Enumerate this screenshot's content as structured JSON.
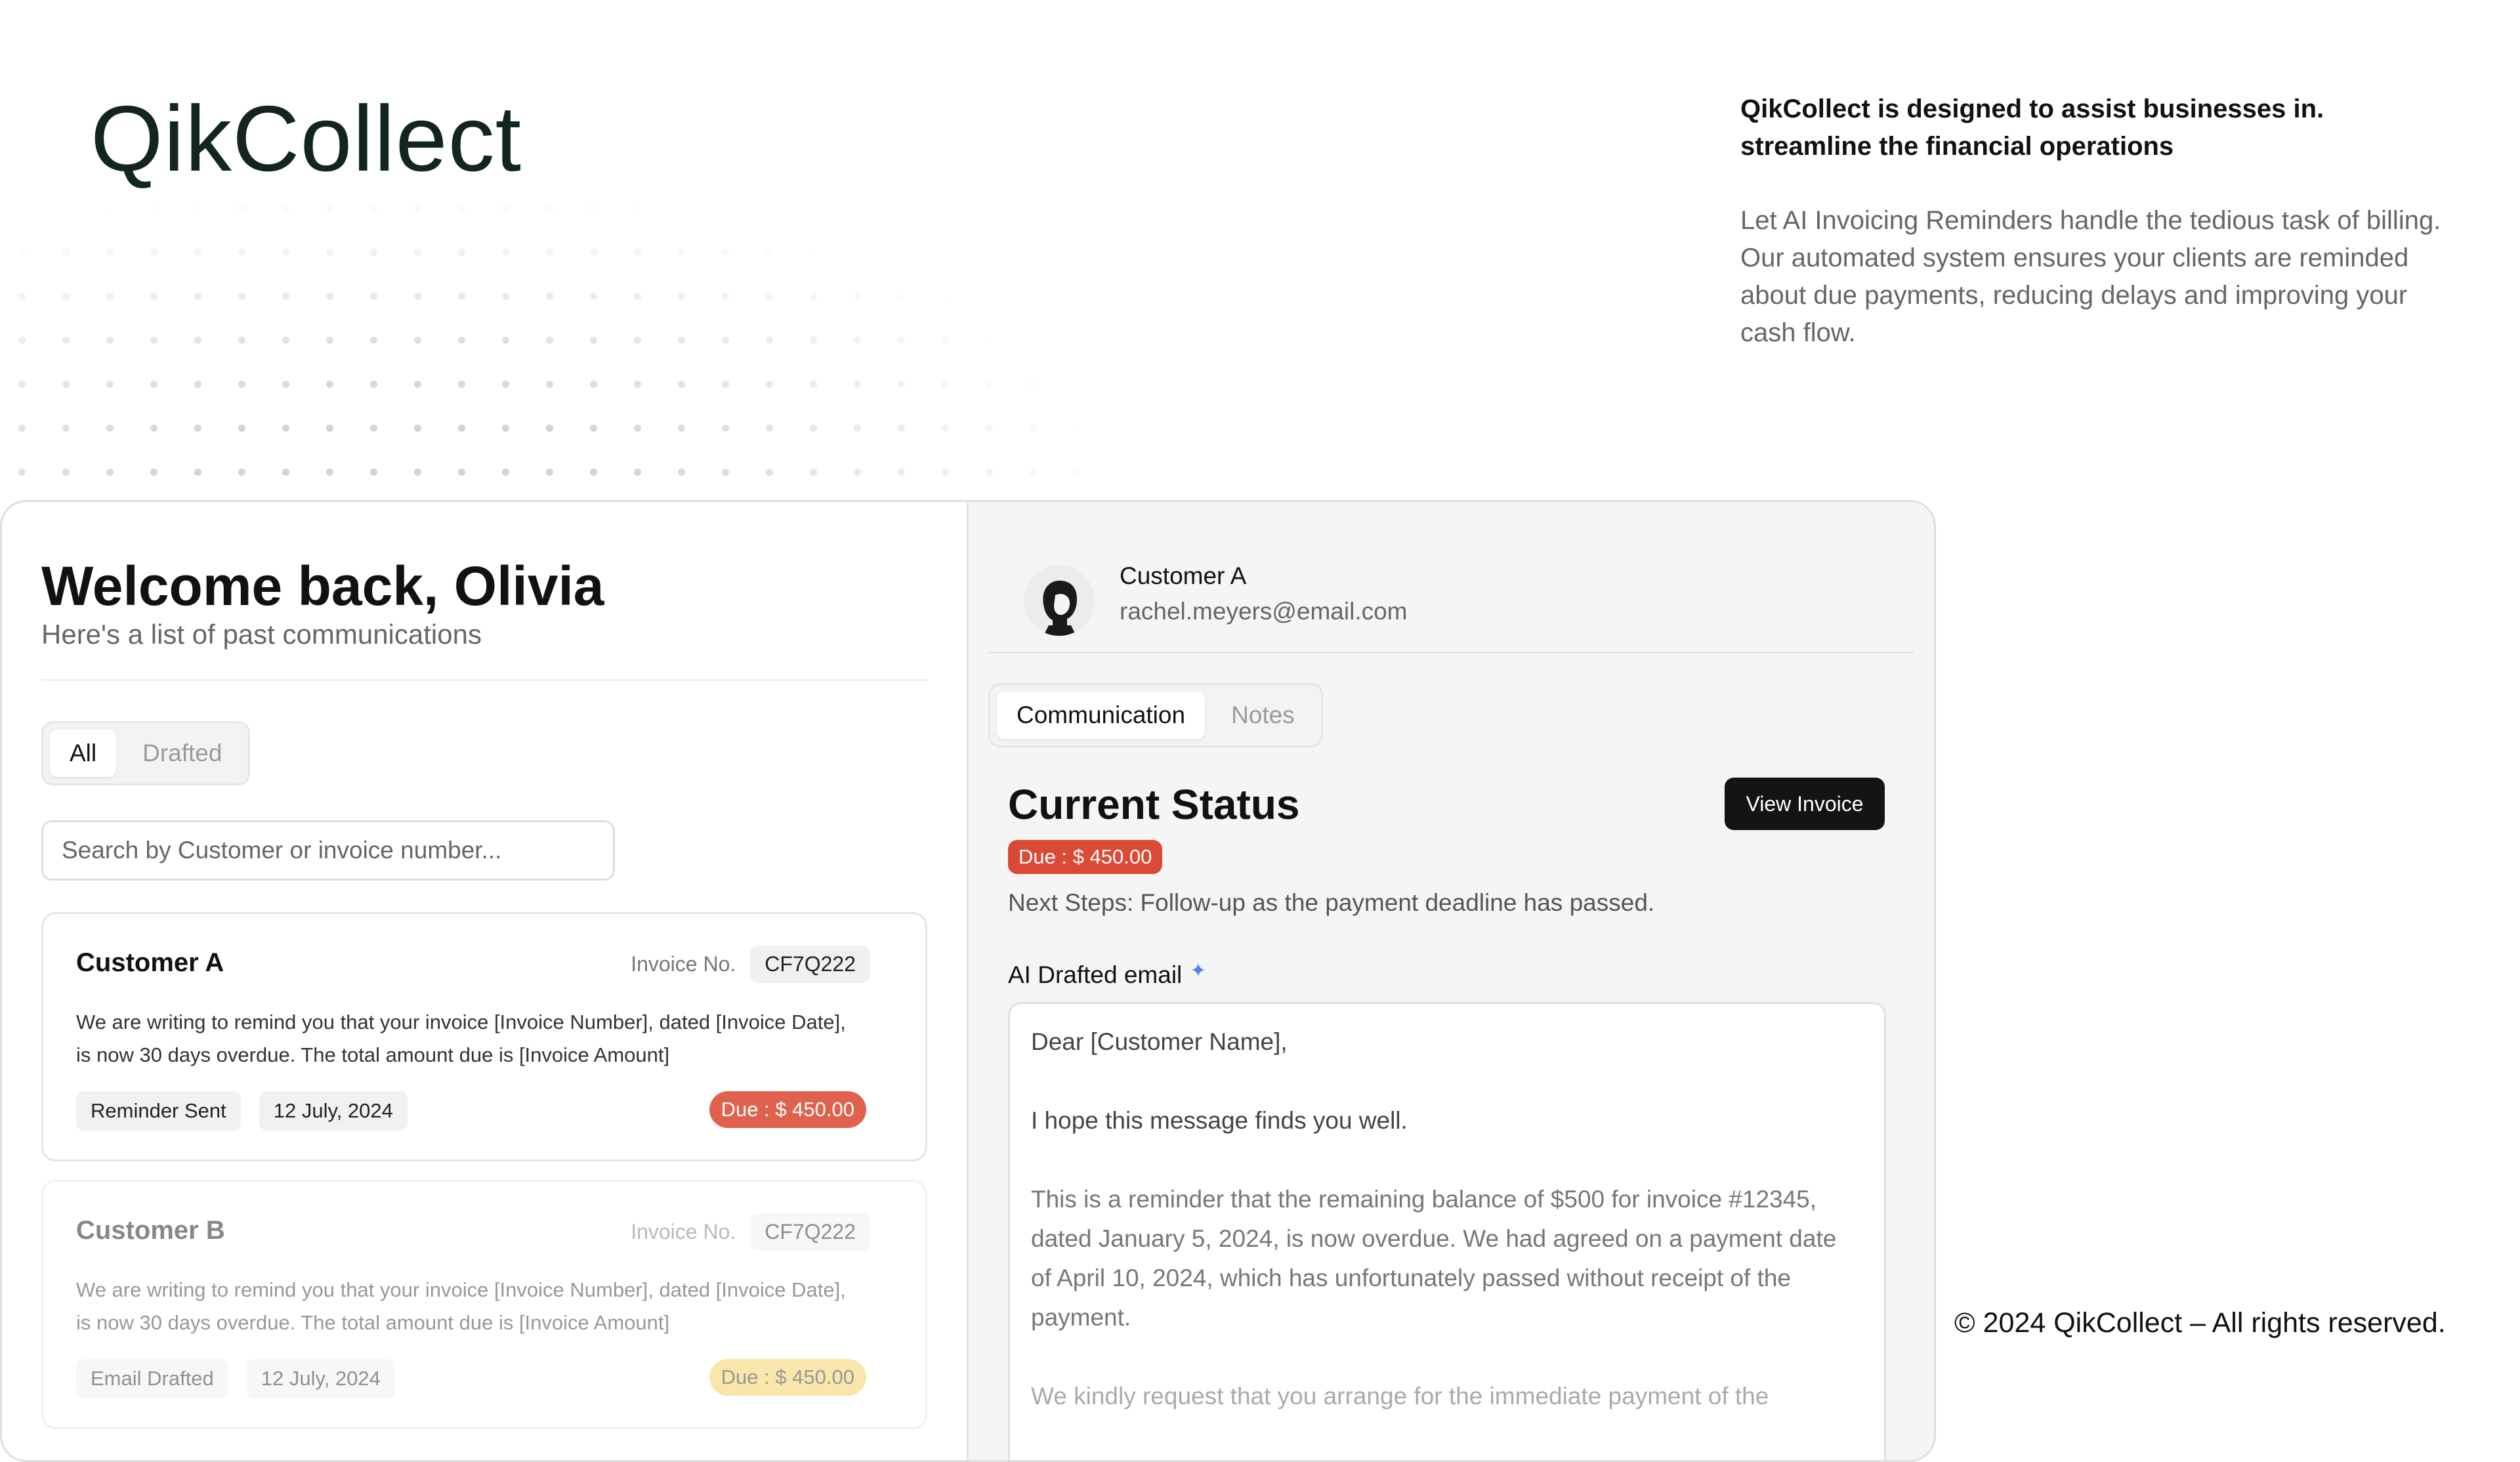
{
  "brand": "QikCollect",
  "intro": {
    "title": "QikCollect is designed to assist businesses in. streamline the financial operations",
    "body": "Let AI Invoicing Reminders handle the tedious task of billing. Our automated system ensures your clients are reminded about due payments, reducing delays and improving your cash flow."
  },
  "footer": "© 2024 QikCollect – All rights reserved.",
  "left": {
    "welcome": "Welcome back, Olivia",
    "subtitle": "Here's a list of past communications",
    "tabs": [
      "All",
      "Drafted"
    ],
    "search_placeholder": "Search by Customer or invoice number...",
    "cards": [
      {
        "customer": "Customer A",
        "invoice_label": "Invoice No.",
        "invoice_no": "CF7Q222",
        "text": "We are writing to remind you that your invoice [Invoice Number], dated [Invoice Date], is now 30 days overdue. The total amount due is [Invoice Amount]",
        "status": "Reminder Sent",
        "date": "12 July, 2024",
        "due": "Due : $ 450.00"
      },
      {
        "customer": "Customer B",
        "invoice_label": "Invoice No.",
        "invoice_no": "CF7Q222",
        "text": "We are writing to remind you that your invoice [Invoice Number], dated [Invoice Date], is now 30 days overdue. The total amount due is [Invoice Amount]",
        "status": "Email Drafted",
        "date": "12 July, 2024",
        "due": "Due : $ 450.00"
      }
    ]
  },
  "detail": {
    "customer": "Customer A",
    "email": "rachel.meyers@email.com",
    "tabs": [
      "Communication",
      "Notes"
    ],
    "status_title": "Current Status",
    "view_invoice": "View Invoice",
    "due": "Due : $ 450.00",
    "next_steps": "Next Steps: Follow-up as the payment deadline has passed.",
    "ai_label": "AI Drafted email",
    "sparkle_icon": "sparkle-icon",
    "email_lines": [
      "Dear [Customer Name],",
      "I hope this message finds you well.",
      "This is a reminder that the remaining balance of $500 for invoice #12345, dated January 5, 2024, is now overdue. We had agreed on a payment date of April 10, 2024, which has unfortunately passed without receipt of the payment.",
      "We kindly request that you arrange for the immediate payment of the"
    ]
  },
  "colors": {
    "due_red": "#e0624e",
    "due_yellow": "#f4cf58",
    "button_dark": "#141414"
  }
}
